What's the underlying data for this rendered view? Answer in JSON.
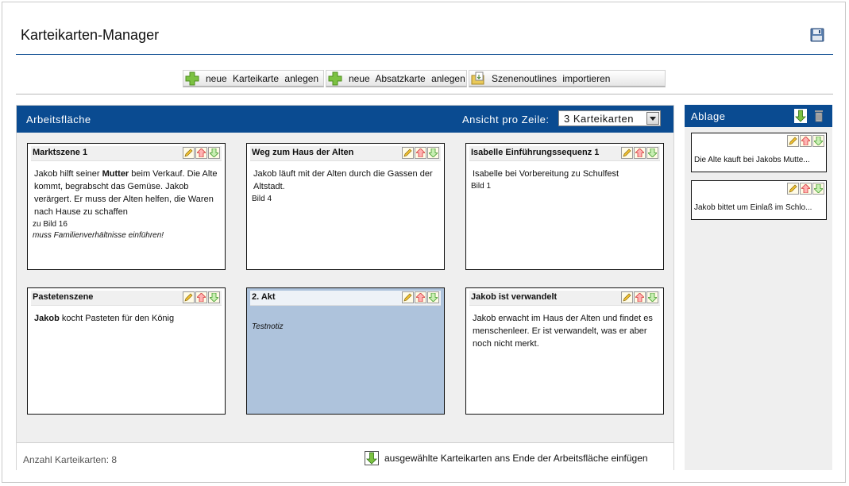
{
  "app": {
    "title": "Karteikarten-Manager"
  },
  "toolbar": {
    "new_card_label": "neue Karteikarte anlegen",
    "new_paragraph_card_label": "neue Absatzkarte anlegen",
    "import_label": "Szenenoutlines importieren"
  },
  "workspace": {
    "title": "Arbeitsfläche",
    "per_row_label": "Ansicht pro Zeile:",
    "per_row_value": "3 Karteikarten",
    "count_label": "Anzahl Karteikarten: 8",
    "insert_label": "ausgewählte Karteikarten ans Ende der Arbeitsfläche einfügen",
    "cards": [
      {
        "title": "Marktszene 1",
        "text_a": "Jakob hilft seiner ",
        "text_bold": "Mutter",
        "text_b": " beim Verkauf. Die Alte kommt, begrabscht das Gemüse. Jakob verärgert. Er muss der Alten helfen, die Waren nach Hause zu schaffen",
        "ref": "zu Bild 16",
        "note": "muss Familienverhältnisse einführen!"
      },
      {
        "title": "Weg zum Haus der Alten",
        "text": "Jakob läuft mit der Alten durch die Gassen der Altstadt.",
        "ref": "Bild 4"
      },
      {
        "title": "Isabelle Einführungssequenz 1",
        "text": "Isabelle bei Vorbereitung zu Schulfest",
        "ref": "Bild 1"
      },
      {
        "title": "Pastetenszene",
        "text_bold": "Jakob",
        "text_b": " kocht Pasteten für den König"
      },
      {
        "title": "2. Akt",
        "note": "Testnotiz",
        "selected": true
      },
      {
        "title": "Jakob ist verwandelt",
        "text": "Jakob erwacht im Haus der Alten und findet es menschenleer. Er ist verwandelt, was er aber noch nicht merkt."
      }
    ]
  },
  "storage": {
    "title": "Ablage",
    "cards": [
      {
        "text": "Die Alte kauft bei Jakobs Mutte..."
      },
      {
        "text": "Jakob bittet um Einlaß im Schlo..."
      }
    ]
  },
  "icons": {
    "save": "floppy-disk-icon",
    "add": "green-plus-icon",
    "import": "folder-import-icon",
    "edit": "pencil-icon",
    "move_up": "red-up-arrow-icon",
    "move_down": "green-down-arrow-icon",
    "trash": "trash-icon"
  },
  "colors": {
    "header": "#0a4b91",
    "selected_card": "#aec3dc",
    "panel_bg": "#efefef"
  }
}
